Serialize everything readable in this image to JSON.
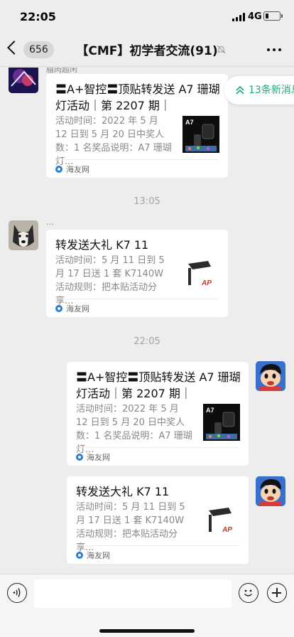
{
  "status_bar": {
    "time": "22:05",
    "network": "4G",
    "battery_level": 0.22
  },
  "nav": {
    "unread_count": "656",
    "title": "【CMF】初学者交流(91)"
  },
  "new_messages_pill": {
    "label": "13条新消息"
  },
  "messages": [
    {
      "sender": "脂肉超闲",
      "card": {
        "title": "〓A+智控〓顶贴转发送 A7 珊瑚灯活动｜第 2207 期｜",
        "desc": "活动时间：2022 年 5 月 12 日到 5 月 20 日中奖人数：1 名奖品说明：A7 珊瑚灯...",
        "source": "海友网"
      }
    },
    {
      "timestamp": "13:05"
    },
    {
      "sender": "...",
      "card": {
        "title": "转发送大礼 K7 11",
        "desc": "活动时间：5 月 11 日到 5 月 17 日送 1 套 K7140W 活动规则：把本贴活动分享...",
        "source": "海友网"
      }
    },
    {
      "timestamp": "22:05"
    },
    {
      "card": {
        "title": "〓A+智控〓顶贴转发送 A7 珊瑚灯活动｜第 2207 期｜",
        "desc": "活动时间：2022 年 5 月 12 日到 5 月 20 日中奖人数：1 名奖品说明：A7 珊瑚灯...",
        "source": "海友网"
      }
    },
    {
      "card": {
        "title": "转发送大礼 K7 11",
        "desc": "活动时间：5 月 11 日到 5 月 17 日送 1 套 K7140W 活动规则：把本贴活动分享...",
        "source": "海友网"
      }
    }
  ],
  "thumbnails": {
    "a7_label": "A7",
    "k7_label": "AP"
  },
  "colors": {
    "accent_green": "#1aad7a",
    "bubble_bg": "#ffffff",
    "chat_bg": "#ededed",
    "source_icon": "#2b7cd3"
  }
}
